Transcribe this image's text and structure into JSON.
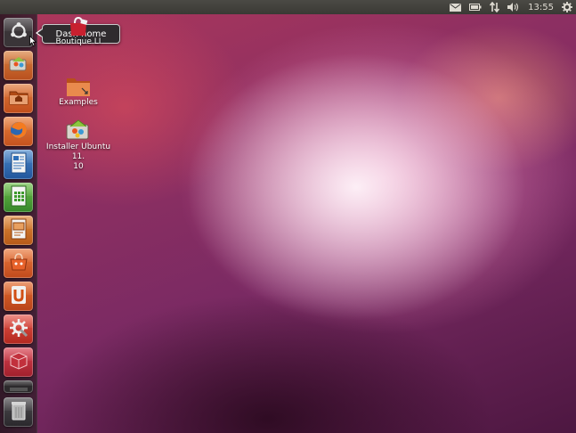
{
  "top_panel": {
    "indicators": [
      "mail-icon",
      "battery-icon",
      "network-icon",
      "volume-icon"
    ],
    "clock": "13:55",
    "session_icon": "gear-icon"
  },
  "launcher": {
    "items": [
      {
        "name": "dash-home",
        "icon": "ubuntu-logo-icon"
      },
      {
        "name": "installer",
        "icon": "installer-icon"
      },
      {
        "name": "home-folder",
        "icon": "home-folder-icon"
      },
      {
        "name": "firefox",
        "icon": "firefox-icon"
      },
      {
        "name": "libreoffice-writer",
        "icon": "writer-icon"
      },
      {
        "name": "libreoffice-calc",
        "icon": "calc-icon"
      },
      {
        "name": "libreoffice-impress",
        "icon": "impress-icon"
      },
      {
        "name": "software-center",
        "icon": "software-center-icon"
      },
      {
        "name": "ubuntu-one",
        "icon": "ubuntu-one-icon"
      },
      {
        "name": "system-settings",
        "icon": "settings-icon"
      },
      {
        "name": "workspace-switcher",
        "icon": "workspaces-icon"
      },
      {
        "name": "trash",
        "icon": "trash-icon"
      }
    ]
  },
  "tooltip": {
    "text": "Dash home"
  },
  "desktop_icons": [
    {
      "label": "Boutique LI",
      "icon": "shopping-bag-icon"
    },
    {
      "label": "Examples",
      "icon": "folder-icon"
    },
    {
      "label_line1": "Installer Ubuntu 11.",
      "label_line2": "10",
      "icon": "installer-icon"
    }
  ],
  "colors": {
    "panel": "#3c3b37",
    "accent_orange": "#e05a22",
    "wallpaper": "#8c2f62"
  }
}
